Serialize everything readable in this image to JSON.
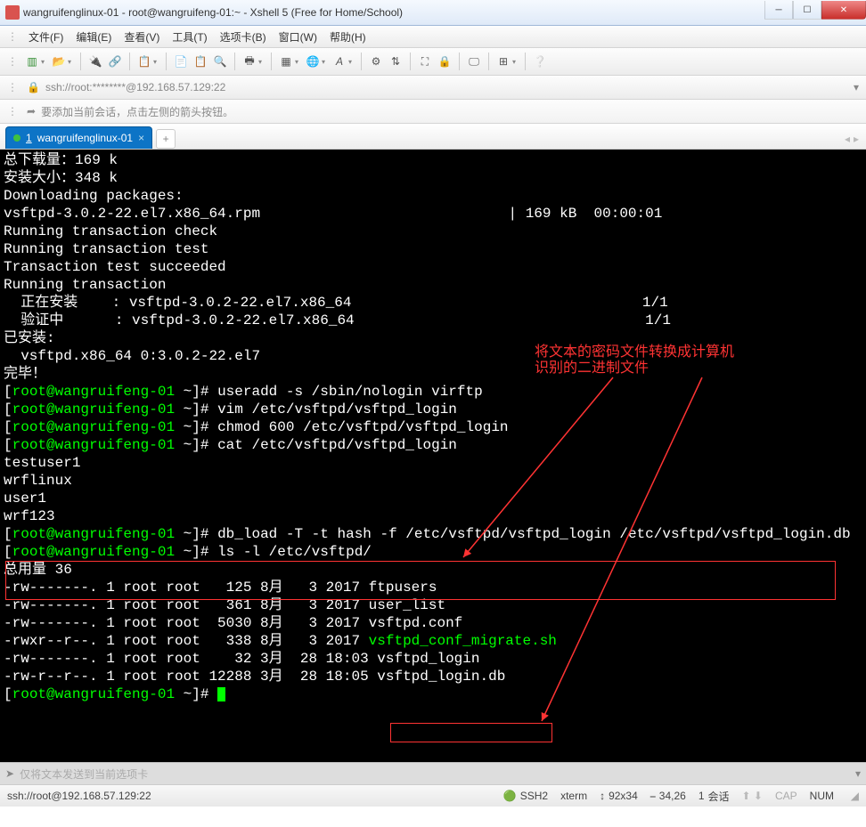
{
  "window": {
    "title": "wangruifenglinux-01 - root@wangruifeng-01:~ - Xshell 5 (Free for Home/School)"
  },
  "menu": {
    "items": [
      "文件(F)",
      "编辑(E)",
      "查看(V)",
      "工具(T)",
      "选项卡(B)",
      "窗口(W)",
      "帮助(H)"
    ]
  },
  "address": {
    "text": "ssh://root:********@192.168.57.129:22"
  },
  "hint": {
    "text": "要添加当前会话，点击左侧的箭头按钮。"
  },
  "tab": {
    "index": "1",
    "label": "wangruifenglinux-01"
  },
  "annotation": {
    "line1": "将文本的密码文件转换成计算机",
    "line2": "识别的二进制文件"
  },
  "terminal": {
    "lines": [
      {
        "t": "plain",
        "v": "总下载量：169 k"
      },
      {
        "t": "plain",
        "v": "安装大小：348 k"
      },
      {
        "t": "plain",
        "v": "Downloading packages:"
      },
      {
        "t": "plain",
        "v": "vsftpd-3.0.2-22.el7.x86_64.rpm                             | 169 kB  00:00:01"
      },
      {
        "t": "plain",
        "v": "Running transaction check"
      },
      {
        "t": "plain",
        "v": "Running transaction test"
      },
      {
        "t": "plain",
        "v": "Transaction test succeeded"
      },
      {
        "t": "plain",
        "v": "Running transaction"
      },
      {
        "t": "plain",
        "v": "  正在安装    : vsftpd-3.0.2-22.el7.x86_64                                  1/1"
      },
      {
        "t": "plain",
        "v": "  验证中      : vsftpd-3.0.2-22.el7.x86_64                                  1/1"
      },
      {
        "t": "plain",
        "v": ""
      },
      {
        "t": "plain",
        "v": "已安装:"
      },
      {
        "t": "plain",
        "v": "  vsftpd.x86_64 0:3.0.2-22.el7"
      },
      {
        "t": "plain",
        "v": ""
      },
      {
        "t": "plain",
        "v": "完毕！"
      },
      {
        "t": "prompt",
        "cmd": "useradd -s /sbin/nologin virftp"
      },
      {
        "t": "prompt",
        "cmd": "vim /etc/vsftpd/vsftpd_login"
      },
      {
        "t": "prompt",
        "cmd": "chmod 600 /etc/vsftpd/vsftpd_login"
      },
      {
        "t": "prompt",
        "cmd": "cat /etc/vsftpd/vsftpd_login"
      },
      {
        "t": "plain",
        "v": "testuser1"
      },
      {
        "t": "plain",
        "v": "wrflinux"
      },
      {
        "t": "plain",
        "v": "user1"
      },
      {
        "t": "plain",
        "v": "wrf123"
      },
      {
        "t": "prompt",
        "cmd": "db_load -T -t hash -f /etc/vsftpd/vsftpd_login /etc/vsftpd/vsftpd_login.db",
        "wrap": true
      },
      {
        "t": "prompt",
        "cmd": "ls -l /etc/vsftpd/"
      },
      {
        "t": "plain",
        "v": "总用量 36"
      },
      {
        "t": "plain",
        "v": "-rw-------. 1 root root   125 8月   3 2017 ftpusers"
      },
      {
        "t": "plain",
        "v": "-rw-------. 1 root root   361 8月   3 2017 user_list"
      },
      {
        "t": "plain",
        "v": "-rw-------. 1 root root  5030 8月   3 2017 vsftpd.conf"
      },
      {
        "t": "exec",
        "v": "-rwxr--r--. 1 root root   338 8月   3 2017 ",
        "exe": "vsftpd_conf_migrate.sh"
      },
      {
        "t": "plain",
        "v": "-rw-------. 1 root root    32 3月  28 18:03 vsftpd_login"
      },
      {
        "t": "plain",
        "v": "-rw-r--r--. 1 root root 12288 3月  28 18:05 vsftpd_login.db"
      },
      {
        "t": "prompt",
        "cmd": "",
        "cursor": true
      }
    ],
    "prompt_user": "root",
    "prompt_host": "wangruifeng-01",
    "prompt_path": "~"
  },
  "sendbar": {
    "placeholder": "仅将文本发送到当前选项卡"
  },
  "status": {
    "conn": "ssh://root@192.168.57.129:22",
    "proto": "SSH2",
    "term": "xterm",
    "size": "92x34",
    "pos": "34,26",
    "sessions_label": "会话",
    "sessions": "1",
    "cap": "CAP",
    "num": "NUM"
  }
}
